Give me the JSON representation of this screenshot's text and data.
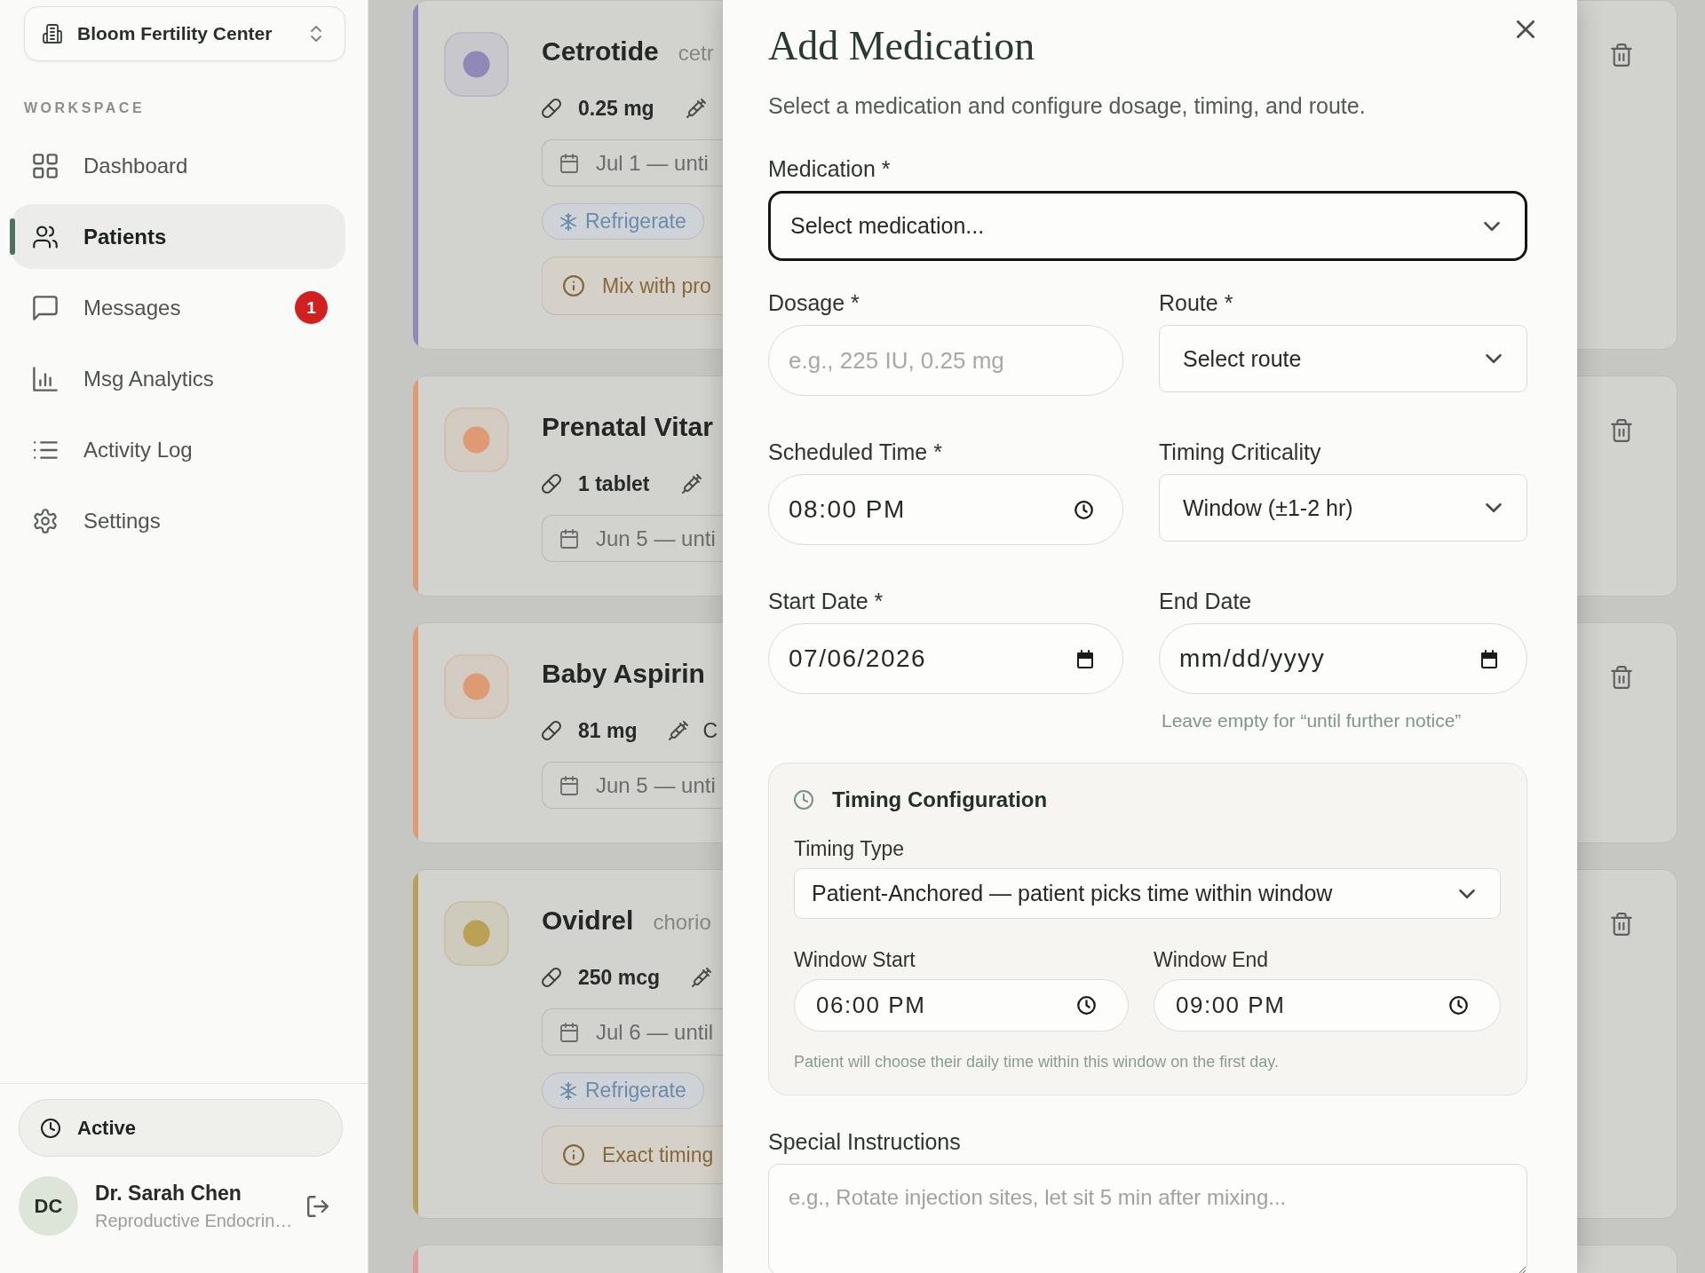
{
  "sidebar": {
    "org_switcher": {
      "name": "Bloom Fertility Center"
    },
    "section_label": "WORKSPACE",
    "nav_items": [
      {
        "label": "Dashboard",
        "selected": false
      },
      {
        "label": "Patients",
        "selected": true
      },
      {
        "label": "Messages",
        "selected": false,
        "badge": "1"
      },
      {
        "label": "Msg Analytics",
        "selected": false
      },
      {
        "label": "Activity Log",
        "selected": false
      },
      {
        "label": "Settings",
        "selected": false
      }
    ],
    "status": {
      "label": "Active"
    },
    "user": {
      "initials": "DC",
      "name": "Dr. Sarah Chen",
      "role": "Reproductive Endocrin…"
    }
  },
  "medication_cards": [
    {
      "name": "Cetrotide",
      "subtitle": "cetr",
      "color": "#9089b8",
      "dose": "0.25 mg",
      "dates": "Jul 1 — unti",
      "storage": "Refrigerate",
      "note": "Mix with pro"
    },
    {
      "name": "Prenatal Vitar",
      "color": "#de9a72",
      "dose": "1 tablet",
      "dates": "Jun 5 — unti"
    },
    {
      "name": "Baby Aspirin",
      "color": "#de9a72",
      "dose": "81 mg",
      "route": "C",
      "dates": "Jun 5 — unti"
    },
    {
      "name": "Ovidrel",
      "subtitle": "chorio",
      "color": "#baa055",
      "dose": "250 mcg",
      "dates": "Jul 6 — until",
      "storage": "Refrigerate",
      "note": "Exact timing"
    },
    {
      "color": "#e39a9a"
    }
  ],
  "modal": {
    "title": "Add Medication",
    "subtitle": "Select a medication and configure dosage, timing, and route.",
    "medication": {
      "label": "Medication *",
      "value": "Select medication...",
      "focused": true
    },
    "dosage": {
      "label": "Dosage *",
      "placeholder": "e.g., 225 IU, 0.25 mg"
    },
    "route": {
      "label": "Route *",
      "value": "Select route"
    },
    "scheduled_time": {
      "label": "Scheduled Time *",
      "value": "08:00 PM"
    },
    "timing_criticality": {
      "label": "Timing Criticality",
      "value": "Window (±1-2 hr)"
    },
    "start_date": {
      "label": "Start Date *",
      "value": "07/06/2026"
    },
    "end_date": {
      "label": "End Date",
      "placeholder": "mm/dd/yyyy",
      "help_text": "Leave empty for “until further notice”"
    },
    "timing_configuration": {
      "title": "Timing Configuration",
      "timing_type": {
        "label": "Timing Type",
        "value": "Patient-Anchored — patient picks time within window"
      },
      "window_start": {
        "label": "Window Start",
        "value": "06:00 PM"
      },
      "window_end": {
        "label": "Window End",
        "value": "09:00 PM"
      },
      "help_text": "Patient will choose their daily time within this window on the first day."
    },
    "special_instructions": {
      "label": "Special Instructions",
      "placeholder": "e.g., Rotate injection sites, let sit 5 min after mixing..."
    }
  }
}
